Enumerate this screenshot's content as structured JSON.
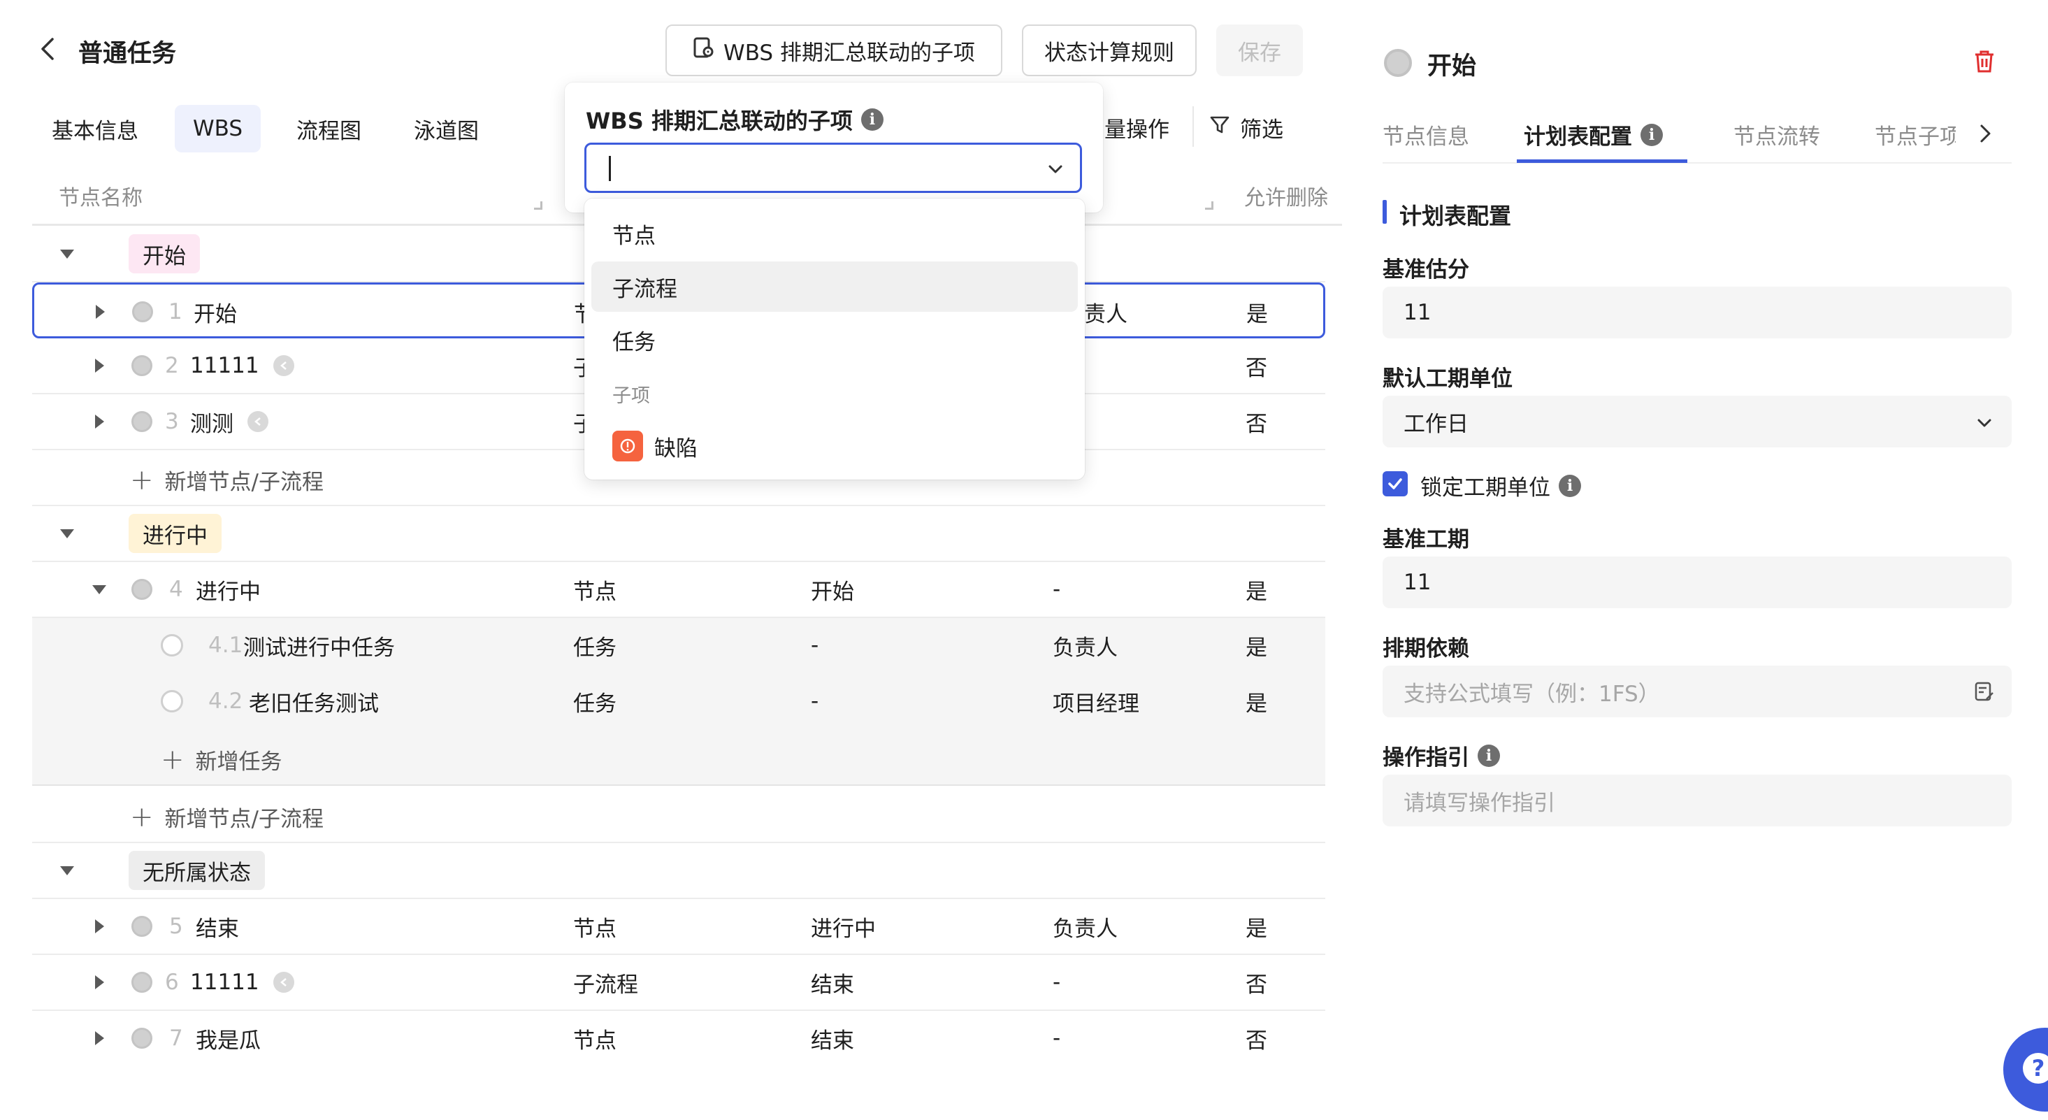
{
  "header": {
    "title": "普通任务",
    "wbs_button": "WBS 排期汇总联动的子项",
    "status_rule_button": "状态计算规则",
    "save_button": "保存"
  },
  "tabs": [
    {
      "label": "基本信息"
    },
    {
      "label": "WBS"
    },
    {
      "label": "流程图"
    },
    {
      "label": "泳道图"
    }
  ],
  "toolbar": {
    "batch_label": "量操作",
    "filter_label": "筛选"
  },
  "columns": {
    "name": "节点名称",
    "allow_delete": "允许删除"
  },
  "groups": [
    {
      "tag": "开始",
      "tag_bg": "#fde7f3"
    },
    {
      "tag": "进行中",
      "tag_bg": "#fff3d6"
    },
    {
      "tag": "无所属状态",
      "tag_bg": "#ededed"
    }
  ],
  "rows": [
    {
      "num": "1",
      "name": "开始",
      "type": "节",
      "pre": "",
      "owner": "责人",
      "del": "是"
    },
    {
      "num": "2",
      "name": "11111",
      "type": "子",
      "pre": "",
      "owner": "",
      "del": "否"
    },
    {
      "num": "3",
      "name": "测测",
      "type": "子",
      "pre": "",
      "owner": "",
      "del": "否"
    },
    {
      "num": "4",
      "name": "进行中",
      "type": "节点",
      "pre": "开始",
      "owner": "-",
      "del": "是"
    },
    {
      "num": "4.1",
      "name": "测试进行中任务",
      "type": "任务",
      "pre": "-",
      "owner": "负责人",
      "del": "是"
    },
    {
      "num": "4.2",
      "name": "老旧任务测试",
      "type": "任务",
      "pre": "-",
      "owner": "项目经理",
      "del": "是"
    },
    {
      "num": "5",
      "name": "结束",
      "type": "节点",
      "pre": "进行中",
      "owner": "负责人",
      "del": "是"
    },
    {
      "num": "6",
      "name": "11111",
      "type": "子流程",
      "pre": "结束",
      "owner": "-",
      "del": "否"
    },
    {
      "num": "7",
      "name": "我是瓜",
      "type": "节点",
      "pre": "结束",
      "owner": "-",
      "del": "否"
    }
  ],
  "add_node_label": "新增节点/子流程",
  "add_task_label": "新增任务",
  "popover": {
    "label": "WBS 排期汇总联动的子项",
    "options": [
      "节点",
      "子流程",
      "任务"
    ],
    "group_label": "子项",
    "group_option": "缺陷"
  },
  "right_panel": {
    "title": "开始",
    "tabs": [
      "节点信息",
      "计划表配置",
      "节点流转",
      "节点子项"
    ],
    "section_title": "计划表配置",
    "base_estimate_label": "基准估分",
    "base_estimate_value": "11",
    "default_unit_label": "默认工期单位",
    "default_unit_value": "工作日",
    "lock_unit_label": "锁定工期单位",
    "base_period_label": "基准工期",
    "base_period_value": "11",
    "dependency_label": "排期依赖",
    "dependency_placeholder": "支持公式填写（例：1FS）",
    "guide_label": "操作指引",
    "guide_placeholder": "请填写操作指引"
  },
  "colors": {
    "accent": "#3d5bdc",
    "defect": "#f5633f",
    "delete": "#e02f2f"
  }
}
